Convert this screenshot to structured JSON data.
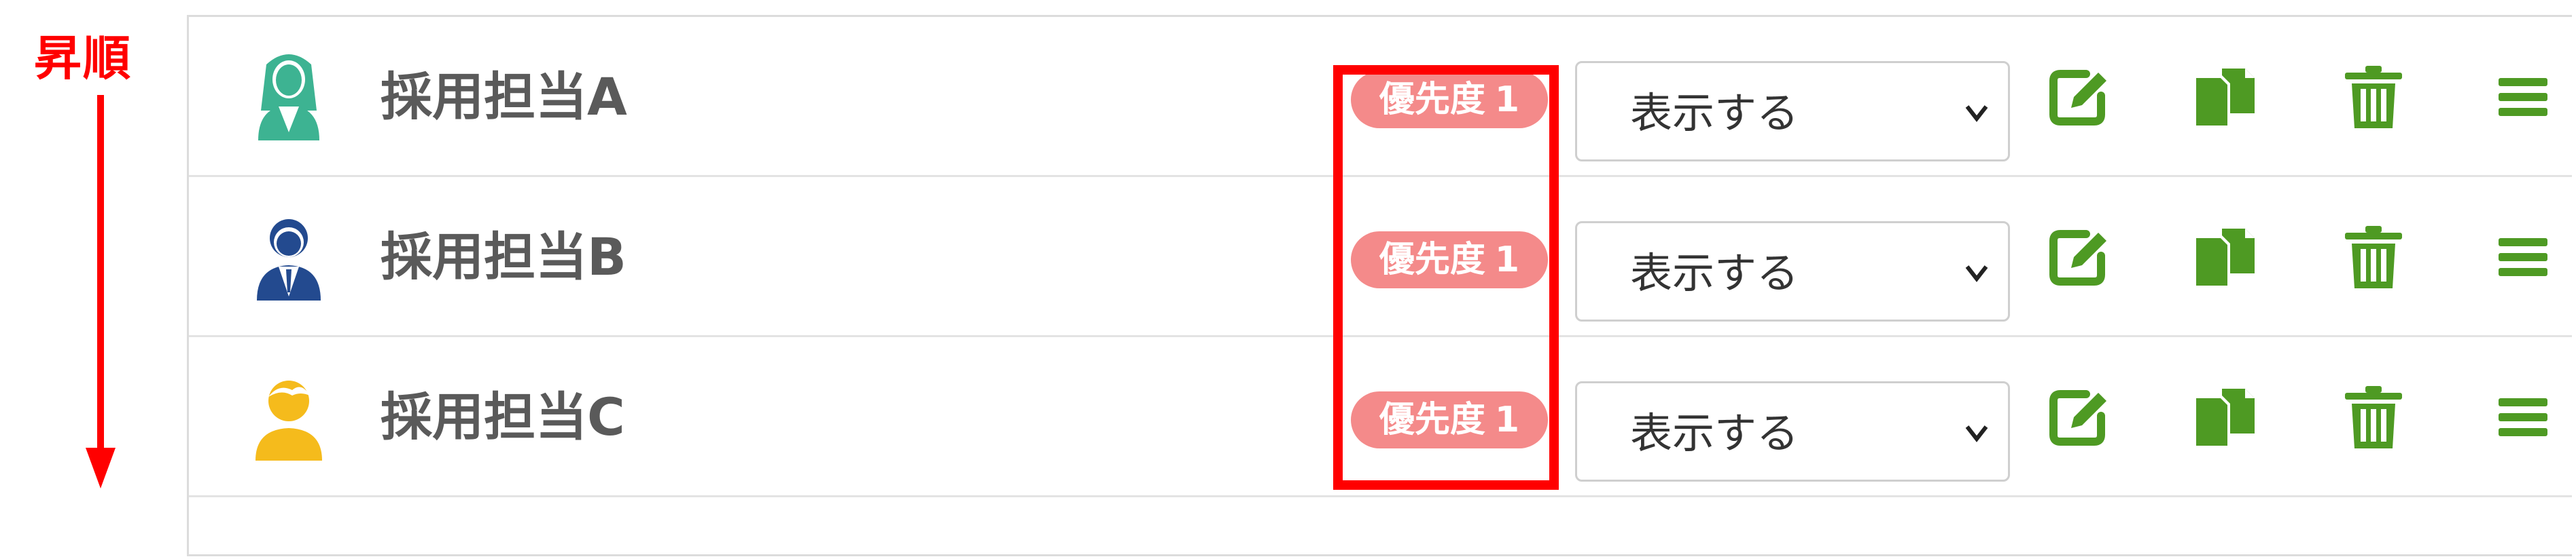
{
  "sort": {
    "label": "昇順",
    "color": "#ff0000"
  },
  "badge": {
    "prefix": "優先度",
    "color": "#f48a8a"
  },
  "colors": {
    "accent_green": "#4e9a23",
    "highlight": "#ff0000"
  },
  "rows": [
    {
      "name": "採用担当A",
      "priority": "1",
      "visibility": "表示する",
      "avatar_icon": "female-recruiter-icon",
      "avatar_color": "#3db392"
    },
    {
      "name": "採用担当B",
      "priority": "1",
      "visibility": "表示する",
      "avatar_icon": "male-businessman-icon",
      "avatar_color": "#234a8f"
    },
    {
      "name": "採用担当C",
      "priority": "1",
      "visibility": "表示する",
      "avatar_icon": "person-icon",
      "avatar_color": "#f5bb1c"
    }
  ],
  "actions": [
    "edit-icon",
    "copy-icon",
    "trash-icon",
    "menu-icon"
  ]
}
